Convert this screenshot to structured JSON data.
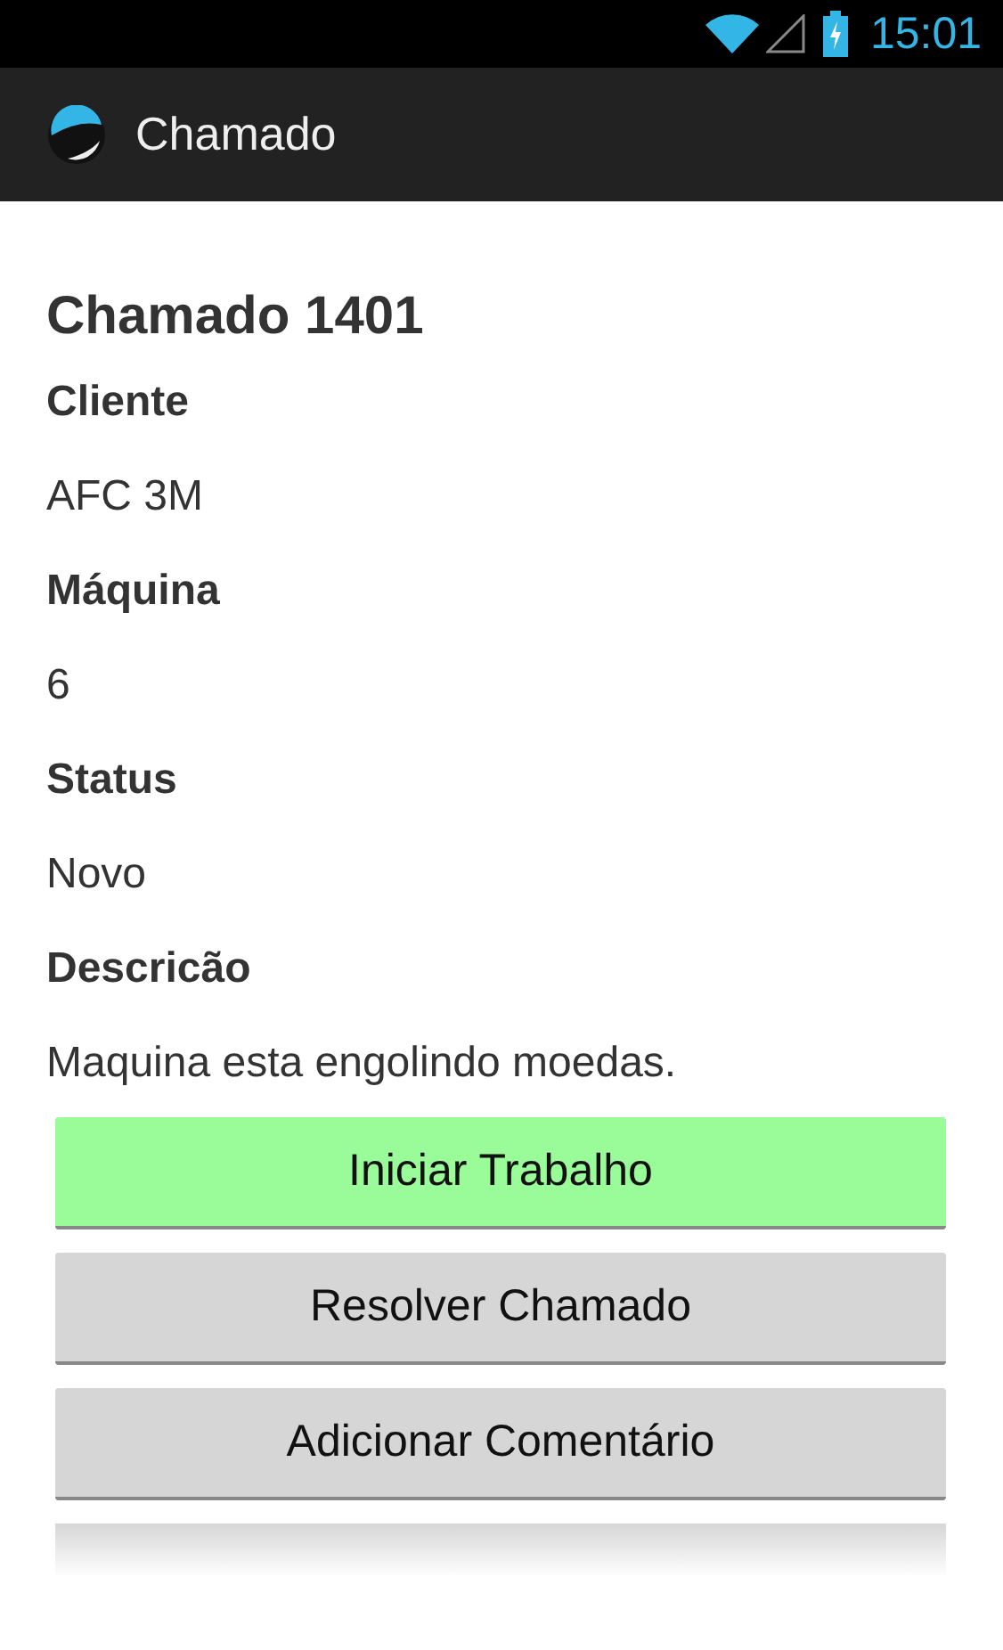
{
  "status_bar": {
    "time": "15:01"
  },
  "app_bar": {
    "title": "Chamado"
  },
  "heading": "Chamado 1401",
  "fields": [
    {
      "label": "Cliente",
      "value": "AFC 3M"
    },
    {
      "label": "Máquina",
      "value": "6"
    },
    {
      "label": "Status",
      "value": "Novo"
    },
    {
      "label": "Descricão",
      "value": "Maquina esta engolindo moedas."
    }
  ],
  "buttons": [
    {
      "label": "Iniciar Trabalho",
      "color": "#99fc99"
    },
    {
      "label": "Resolver Chamado",
      "color": "#d6d6d6"
    },
    {
      "label": "Adicionar Comentário",
      "color": "#d6d6d6"
    }
  ]
}
